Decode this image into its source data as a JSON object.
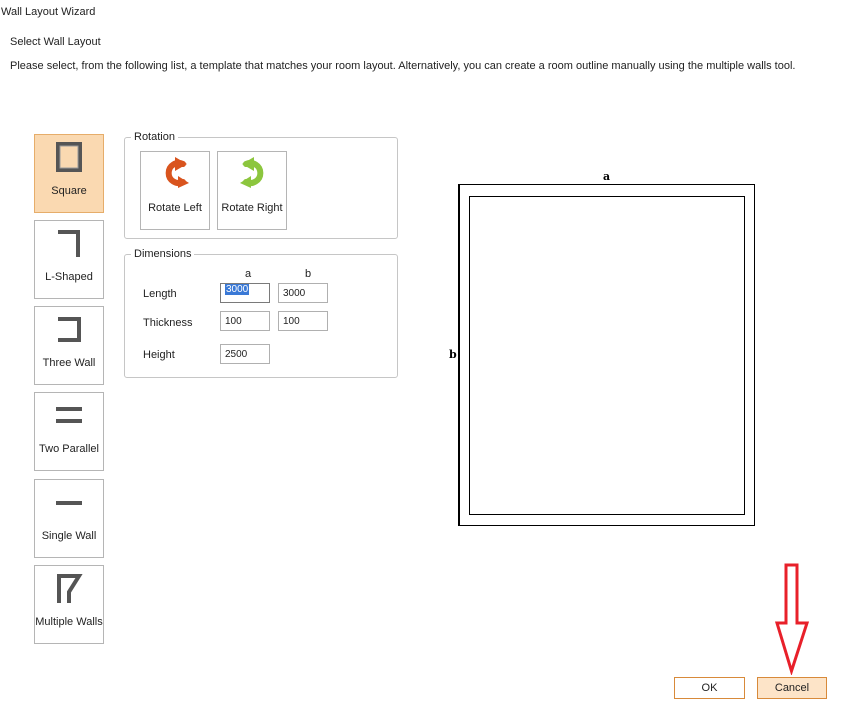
{
  "window": {
    "title": "Wall Layout Wizard"
  },
  "heading": "Select Wall Layout",
  "instructions": "Please select, from the following list, a template that matches your room layout. Alternatively, you can create a room outline manually using the multiple walls tool.",
  "templates": [
    {
      "label": "Square",
      "icon": "square-wall-icon",
      "selected": true
    },
    {
      "label": "L-Shaped",
      "icon": "l-shaped-wall-icon",
      "selected": false
    },
    {
      "label": "Three Wall",
      "icon": "three-wall-icon",
      "selected": false
    },
    {
      "label": "Two Parallel",
      "icon": "two-parallel-wall-icon",
      "selected": false
    },
    {
      "label": "Single Wall",
      "icon": "single-wall-icon",
      "selected": false
    },
    {
      "label": "Multiple Walls",
      "icon": "multiple-walls-icon",
      "selected": false
    }
  ],
  "rotation": {
    "legend": "Rotation",
    "rotate_left_label": "Rotate Left",
    "rotate_right_label": "Rotate Right"
  },
  "dimensions": {
    "legend": "Dimensions",
    "col_a": "a",
    "col_b": "b",
    "length_label": "Length",
    "thickness_label": "Thickness",
    "height_label": "Height",
    "length_a": "3000",
    "length_b": "3000",
    "thickness_a": "100",
    "thickness_b": "100",
    "height": "2500"
  },
  "preview": {
    "label_a": "a",
    "label_b": "b"
  },
  "footer": {
    "ok_label": "OK",
    "cancel_label": "Cancel"
  },
  "colors": {
    "selected_bg": "#fad9b1",
    "accent_border": "#d88a3a",
    "rotate_left_icon": "#d9541e",
    "rotate_right_icon": "#8cc63e",
    "annotation_arrow": "#e8202a"
  }
}
